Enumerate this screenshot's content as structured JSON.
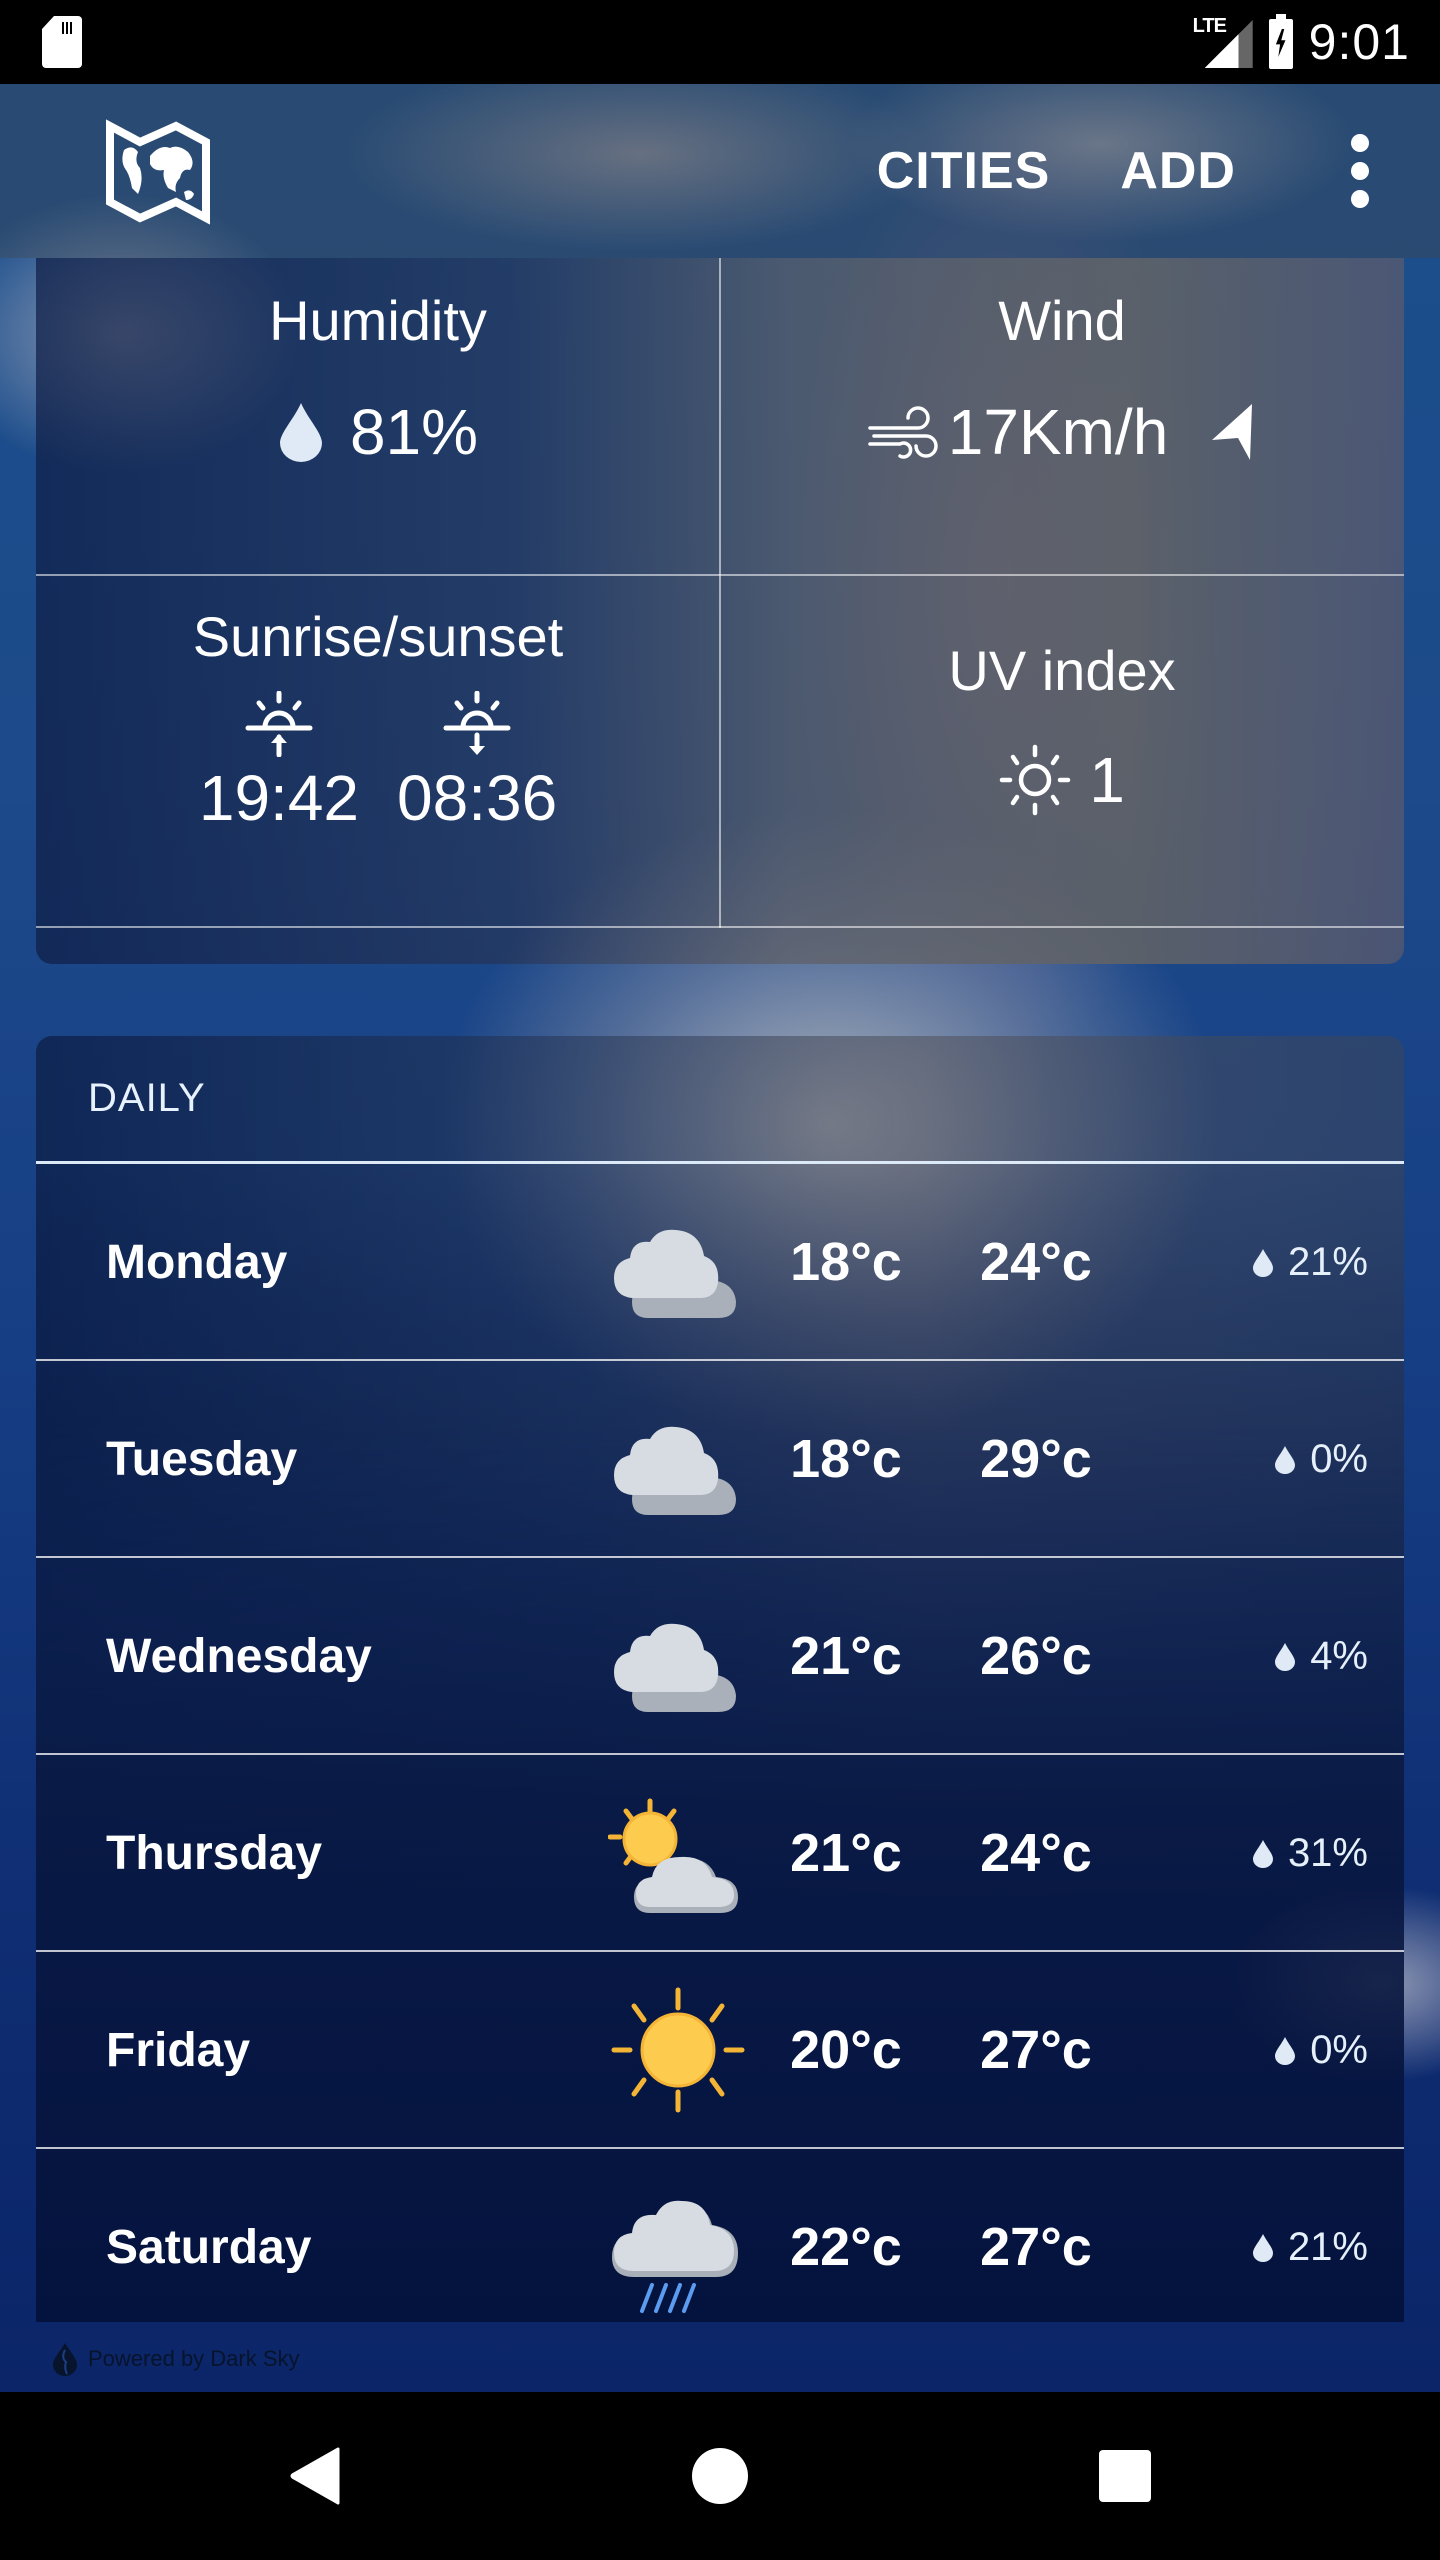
{
  "status_bar": {
    "time": "9:01",
    "network_label": "LTE",
    "icons": [
      "sd-card-icon",
      "lte-signal-icon",
      "battery-charging-icon"
    ]
  },
  "toolbar": {
    "logo_icon": "world-map-icon",
    "cities_label": "CITIES",
    "add_label": "ADD",
    "overflow_icon": "more-vert-icon"
  },
  "details": {
    "humidity": {
      "label": "Humidity",
      "value": "81%",
      "icon": "water-drop-icon"
    },
    "wind": {
      "label": "Wind",
      "value": "17Km/h",
      "icon": "wind-icon",
      "direction_icon": "navigation-arrow-icon"
    },
    "sunrise_sunset": {
      "label": "Sunrise/sunset",
      "sunrise": {
        "time": "19:42",
        "icon": "sunrise-icon"
      },
      "sunset": {
        "time": "08:36",
        "icon": "sunset-icon"
      }
    },
    "uv": {
      "label": "UV index",
      "value": "1",
      "icon": "sun-outline-icon"
    }
  },
  "daily": {
    "title": "DAILY",
    "days": [
      {
        "name": "Monday",
        "icon": "cloudy",
        "min": "18°c",
        "max": "24°c",
        "precip": "21%"
      },
      {
        "name": "Tuesday",
        "icon": "cloudy",
        "min": "18°c",
        "max": "29°c",
        "precip": "0%"
      },
      {
        "name": "Wednesday",
        "icon": "cloudy",
        "min": "21°c",
        "max": "26°c",
        "precip": "4%"
      },
      {
        "name": "Thursday",
        "icon": "partly-cloudy",
        "min": "21°c",
        "max": "24°c",
        "precip": "31%"
      },
      {
        "name": "Friday",
        "icon": "clear-day",
        "min": "20°c",
        "max": "27°c",
        "precip": "0%"
      },
      {
        "name": "Saturday",
        "icon": "rain",
        "min": "22°c",
        "max": "27°c",
        "precip": "21%"
      }
    ]
  },
  "footer": {
    "powered_by": "Powered by Dark Sky"
  },
  "colors": {
    "sun_yellow": "#fdcb4e",
    "sun_stroke": "#f4b436",
    "cloud_light": "#d7dce2",
    "cloud_shadow": "#a9b0b9",
    "rain_blue": "#5b9cf0",
    "drop": "#dfeaf6"
  },
  "nav_bar": {
    "back_icon": "back-triangle-icon",
    "home_icon": "home-circle-icon",
    "recents_icon": "recents-square-icon"
  }
}
